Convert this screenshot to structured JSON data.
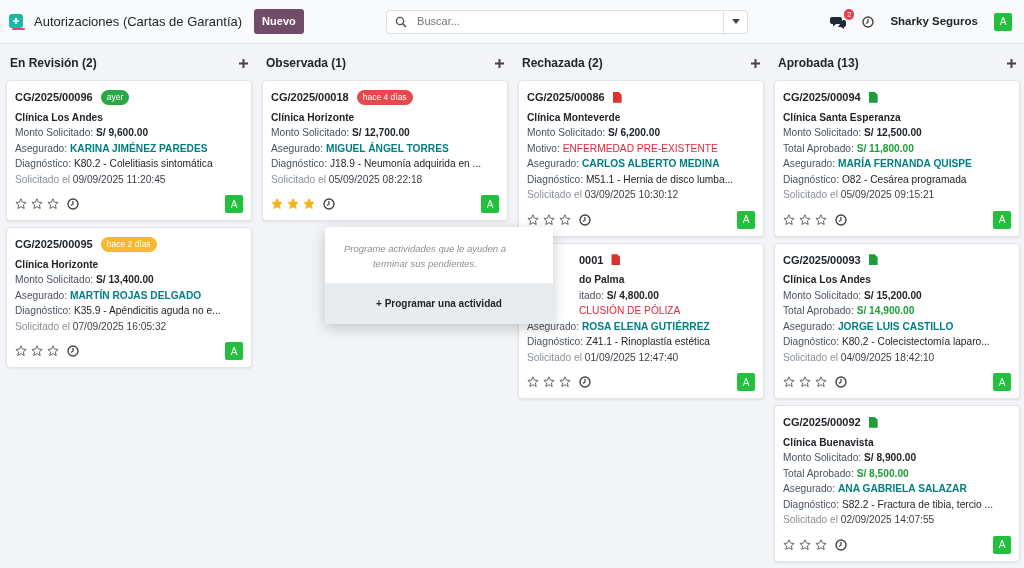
{
  "header": {
    "title": "Autorizaciones (Cartas de Garantía)",
    "new_button": "Nuevo",
    "search": {
      "placeholder": "Buscar..."
    },
    "messages_count": "2",
    "company": "Sharky Seguros",
    "avatar": "A"
  },
  "columns": [
    {
      "title": "En Revisión (2)",
      "cards": [
        {
          "ref": "CG/2025/00096",
          "badge": {
            "text": "ayer",
            "color": "#28a745"
          },
          "lines": [
            {
              "kind": "clinic",
              "value": "Clínica Los Andes"
            },
            {
              "kind": "amount",
              "label": "Monto Solicitado:",
              "value": "S/ 9,600.00"
            },
            {
              "kind": "insured",
              "label": "Asegurado:",
              "value": "KARINA JIMÉNEZ PAREDES"
            },
            {
              "kind": "diagnosis",
              "label": "Diagnóstico:",
              "value": "K80.2 - Colelitiasis sintomática"
            },
            {
              "kind": "date",
              "label": "Solicitado el",
              "value": "09/09/2025 11:20:45"
            }
          ],
          "stars": 0,
          "avatar": "A"
        },
        {
          "ref": "CG/2025/00095",
          "badge": {
            "text": "hace 2 días",
            "color": "#f5b82e"
          },
          "lines": [
            {
              "kind": "clinic",
              "value": "Clínica Horizonte"
            },
            {
              "kind": "amount",
              "label": "Monto Solicitado:",
              "value": "S/ 13,400.00"
            },
            {
              "kind": "insured",
              "label": "Asegurado:",
              "value": "MARTÍN ROJAS DELGADO"
            },
            {
              "kind": "diagnosis",
              "label": "Diagnóstico:",
              "value": "K35.9 - Apéndicitis aguda no e..."
            },
            {
              "kind": "date",
              "label": "Solicitado el",
              "value": "07/09/2025 16:05:32"
            }
          ],
          "stars": 0,
          "avatar": "A"
        }
      ]
    },
    {
      "title": "Observada (1)",
      "cards": [
        {
          "ref": "CG/2025/00018",
          "badge": {
            "text": "hace 4 días",
            "color": "#e5484d"
          },
          "lines": [
            {
              "kind": "clinic",
              "value": "Clínica Horizonte"
            },
            {
              "kind": "amount",
              "label": "Monto Solicitado:",
              "value": "S/ 12,700.00"
            },
            {
              "kind": "insured",
              "label": "Asegurado:",
              "value": "MIGUEL ÁNGEL TORRES"
            },
            {
              "kind": "diagnosis",
              "label": "Diagnóstico:",
              "value": "J18.9 - Neumonía adquirida en ..."
            },
            {
              "kind": "date",
              "label": "Solicitado el",
              "value": "05/09/2025 08:22:18"
            }
          ],
          "stars": 3,
          "avatar": "A",
          "popover": {
            "text": "Programe actividades que le ayuden a terminar sus pendientes.",
            "button": "+ Programar una actividad"
          }
        }
      ]
    },
    {
      "title": "Rechazada (2)",
      "cards": [
        {
          "ref": "CG/2025/00086",
          "color": "#e03131",
          "lines": [
            {
              "kind": "clinic",
              "value": "Clínica Monteverde"
            },
            {
              "kind": "amount",
              "label": "Monto Solicitado:",
              "value": "S/ 6,200.00"
            },
            {
              "kind": "reason",
              "label": "Motivo:",
              "value": "ENFERMEDAD PRE-EXISTENTE"
            },
            {
              "kind": "insured",
              "label": "Asegurado:",
              "value": "CARLOS ALBERTO MEDINA"
            },
            {
              "kind": "diagnosis",
              "label": "Diagnóstico:",
              "value": "M51.1 - Hernia de disco lumba..."
            },
            {
              "kind": "date",
              "label": "Solicitado el",
              "value": "03/09/2025 10:30:12"
            }
          ],
          "stars": 0,
          "avatar": "A"
        },
        {
          "ref": "0001",
          "ref_covered": true,
          "color": "#e03131",
          "lines": [
            {
              "kind": "clinic",
              "value": "do Palma",
              "covered": true
            },
            {
              "kind": "amount",
              "label": "itado:",
              "value": "S/ 4,800.00",
              "covered": true
            },
            {
              "kind": "reason",
              "value": "CLUSIÓN DE PÓLIZA",
              "covered": true
            },
            {
              "kind": "insured",
              "label": "Asegurado:",
              "value": "ROSA ELENA GUTIÉRREZ"
            },
            {
              "kind": "diagnosis",
              "label": "Diagnóstico:",
              "value": "Z41.1 - Rinoplastía estética"
            },
            {
              "kind": "date",
              "label": "Solicitado el",
              "value": "01/09/2025 12:47:40"
            }
          ],
          "stars": 0,
          "avatar": "A"
        }
      ]
    },
    {
      "title": "Aprobada (13)",
      "cards": [
        {
          "ref": "CG/2025/00094",
          "color": "#1f9d3a",
          "lines": [
            {
              "kind": "clinic",
              "value": "Clínica Santa Esperanza"
            },
            {
              "kind": "amount",
              "label": "Monto Solicitado:",
              "value": "S/ 12,500.00"
            },
            {
              "kind": "approved",
              "label": "Total Aprobado:",
              "value": "S/ 11,800.00"
            },
            {
              "kind": "insured",
              "label": "Asegurado:",
              "value": "MARÍA FERNANDA QUISPE"
            },
            {
              "kind": "diagnosis",
              "label": "Diagnóstico:",
              "value": "O82 - Cesárea programada"
            },
            {
              "kind": "date",
              "label": "Solicitado el",
              "value": "05/09/2025 09:15:21"
            }
          ],
          "stars": 0,
          "avatar": "A"
        },
        {
          "ref": "CG/2025/00093",
          "color": "#1f9d3a",
          "lines": [
            {
              "kind": "clinic",
              "value": "Clínica Los Andes"
            },
            {
              "kind": "amount",
              "label": "Monto Solicitado:",
              "value": "S/ 15,200.00"
            },
            {
              "kind": "approved",
              "label": "Total Aprobado:",
              "value": "S/ 14,900.00"
            },
            {
              "kind": "insured",
              "label": "Asegurado:",
              "value": "JORGE LUIS CASTILLO"
            },
            {
              "kind": "diagnosis",
              "label": "Diagnóstico:",
              "value": "K80.2 - Colecistectomía laparo..."
            },
            {
              "kind": "date",
              "label": "Solicitado el",
              "value": "04/09/2025 18:42:10"
            }
          ],
          "stars": 0,
          "avatar": "A"
        },
        {
          "ref": "CG/2025/00092",
          "color": "#1f9d3a",
          "lines": [
            {
              "kind": "clinic",
              "value": "Clínica Buenavista"
            },
            {
              "kind": "amount",
              "label": "Monto Solicitado:",
              "value": "S/ 8,900.00"
            },
            {
              "kind": "approved",
              "label": "Total Aprobado:",
              "value": "S/ 8,500.00"
            },
            {
              "kind": "insured",
              "label": "Asegurado:",
              "value": "ANA GABRIELA SALAZAR"
            },
            {
              "kind": "diagnosis",
              "label": "Diagnóstico:",
              "value": "S82.2 - Fractura de tibia, tercio ..."
            },
            {
              "kind": "date",
              "label": "Solicitado el",
              "value": "02/09/2025 14:07:55"
            }
          ],
          "stars": 0,
          "avatar": "A"
        }
      ]
    }
  ]
}
